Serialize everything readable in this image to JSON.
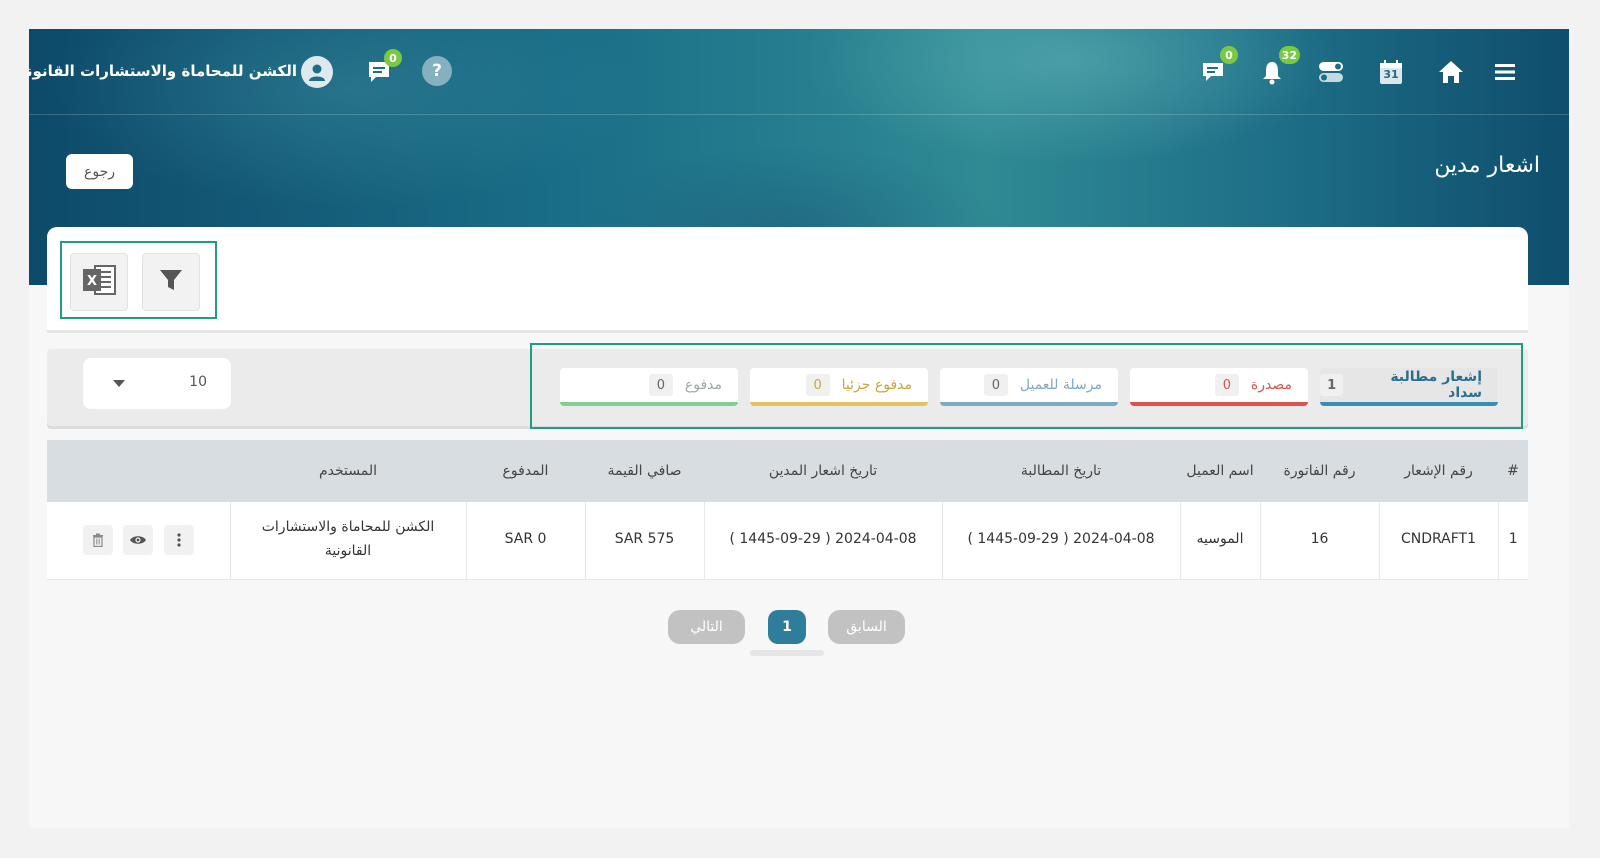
{
  "header": {
    "org_name": "الكشن للمحاماة والاستشارات القانونية",
    "chat_badge": "0",
    "messages_badge": "0",
    "notifications_badge": "32",
    "calendar_day": "31",
    "help_glyph": "?"
  },
  "page": {
    "title": "اشعار مدين",
    "back_label": "رجوع"
  },
  "toolbar": {
    "filter_icon": "filter-icon",
    "excel_icon": "excel-icon",
    "excel_glyph": "X"
  },
  "status_tabs": [
    {
      "label": "إشعار مطالبة سداد",
      "count": "1",
      "color": "#3a8fb0"
    },
    {
      "label": "مصدرة",
      "count": "0",
      "color": "#d9534f"
    },
    {
      "label": "مرسلة للعميل",
      "count": "0",
      "color": "#7ca9c4"
    },
    {
      "label": "مدفوع جزئيا",
      "count": "0",
      "color": "#e2c35d"
    },
    {
      "label": "مدفوع",
      "count": "0",
      "color": "#7fcf8f"
    }
  ],
  "page_size": {
    "value": "10"
  },
  "table": {
    "headers": [
      "#",
      "رقم الإشعار",
      "رقم الفاتورة",
      "اسم العميل",
      "تاريخ المطالبة",
      "تاريخ اشعار المدين",
      "صافي القيمة",
      "المدفوع",
      "المستخدم"
    ],
    "rows": [
      [
        "1",
        "CNDRAFT1",
        "16",
        "الموسيه",
        "2024-04-08 ( 1445-09-29 )",
        "2024-04-08 ( 1445-09-29 )",
        "SAR 575",
        "SAR 0",
        "الكشن للمحاماة والاستشارات القانونية"
      ]
    ]
  },
  "pagination": {
    "prev_label": "السابق",
    "current_page": "1",
    "next_label": "التالي"
  },
  "colors": {
    "accent": "#1f9d83",
    "primary": "#2e7d9a",
    "badge": "#7ac943"
  }
}
